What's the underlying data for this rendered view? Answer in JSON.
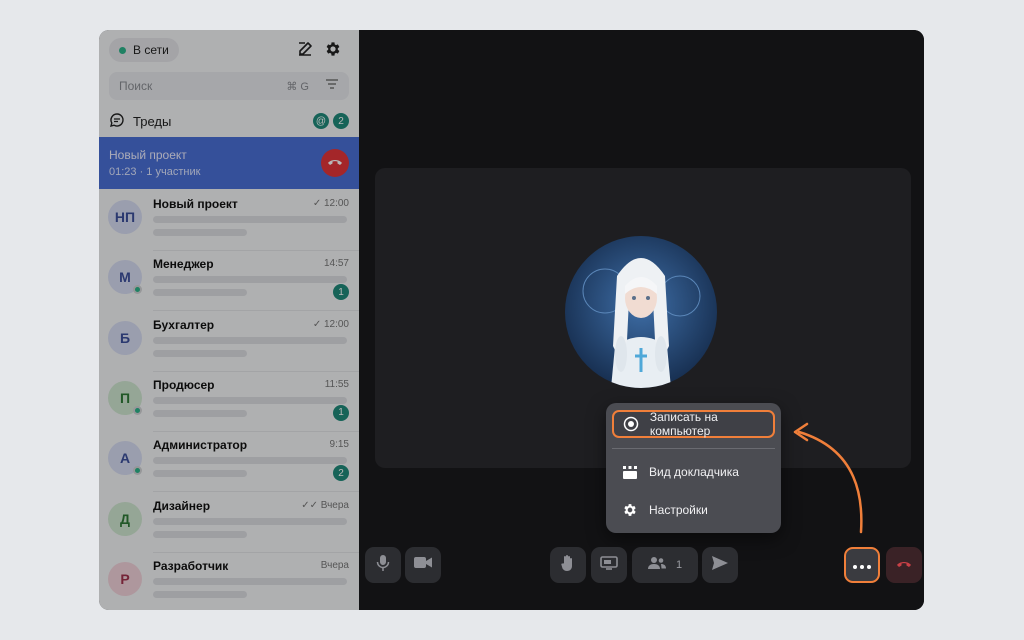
{
  "colors": {
    "accent": "#4a6fd6",
    "online": "#2bb38a",
    "badge": "#1f8a7b",
    "danger": "#e4353a",
    "highlight": "#f07f3a"
  },
  "sidebar": {
    "status": "В сети",
    "search": {
      "placeholder": "Поиск",
      "shortcut": "⌘ G"
    },
    "threads": {
      "label": "Треды",
      "count": "2"
    },
    "active_call": {
      "title": "Новый проект",
      "subtitle": "01:23 · 1 участник"
    },
    "chats": [
      {
        "initials": "НП",
        "name": "Новый проект",
        "time": "✓ 12:00",
        "badge": "",
        "online": false,
        "bg": "#d6dbf1",
        "fg": "#3c4f9c"
      },
      {
        "initials": "М",
        "name": "Менеджер",
        "time": "14:57",
        "badge": "1",
        "online": true,
        "bg": "#d6dbf1",
        "fg": "#3c4f9c"
      },
      {
        "initials": "Б",
        "name": "Бухгалтер",
        "time": "✓ 12:00",
        "badge": "",
        "online": false,
        "bg": "#d6dbf1",
        "fg": "#3c4f9c"
      },
      {
        "initials": "П",
        "name": "Продюсер",
        "time": "11:55",
        "badge": "1",
        "online": true,
        "bg": "#cfe6d0",
        "fg": "#2e7a36"
      },
      {
        "initials": "А",
        "name": "Администратор",
        "time": "9:15",
        "badge": "2",
        "online": true,
        "bg": "#d6dbf1",
        "fg": "#3c4f9c"
      },
      {
        "initials": "Д",
        "name": "Дизайнер",
        "time": "✓✓ Вчера",
        "badge": "",
        "online": false,
        "bg": "#cfe6d0",
        "fg": "#2e7a36"
      },
      {
        "initials": "Р",
        "name": "Разработчик",
        "time": "Вчера",
        "badge": "",
        "online": false,
        "bg": "#f2d2da",
        "fg": "#a3324e"
      }
    ]
  },
  "call": {
    "participants_count": "1",
    "menu": [
      {
        "label": "Записать на компьютер",
        "icon": "record-icon"
      },
      {
        "label": "Вид докладчика",
        "icon": "speaker-view-icon"
      },
      {
        "label": "Настройки",
        "icon": "gear-icon"
      }
    ]
  }
}
